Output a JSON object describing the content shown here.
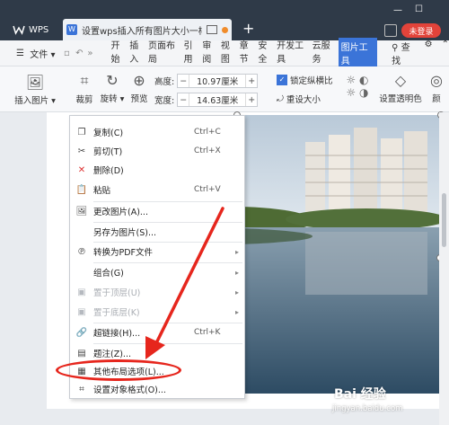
{
  "titlebar": {
    "wps_tab": "WPS",
    "doc_tab": "设置wps插入所有图片大小一样",
    "login_badge": "未登录",
    "new_tab_symbol": "+",
    "minimize_symbol": "—",
    "maximize_symbol": "☐"
  },
  "menubar": {
    "file_label": "文件",
    "tabs": [
      "开始",
      "插入",
      "页面布局",
      "引用",
      "审阅",
      "视图",
      "章节",
      "安全",
      "开发工具",
      "云服务",
      "图片工具"
    ],
    "search_label": "查找"
  },
  "ribbon": {
    "insert_picture": "插入图片",
    "crop": "裁剪",
    "rotate": "旋转",
    "preview": "预览",
    "height_label": "高度:",
    "height_value": "10.97厘米",
    "width_label": "宽度:",
    "width_value": "14.63厘米",
    "lock_ratio": "锁定纵横比",
    "reset_size": "重设大小",
    "set_transparent": "设置透明色",
    "color_partial": "颜"
  },
  "context_menu": {
    "items": [
      {
        "label": "复制(C)",
        "shortcut": "Ctrl+C",
        "icon": "copy-icon"
      },
      {
        "label": "剪切(T)",
        "shortcut": "Ctrl+X",
        "icon": "scissors-icon"
      },
      {
        "label": "删除(D)",
        "shortcut": "",
        "icon": "delete-icon"
      },
      {
        "label": "粘贴",
        "shortcut": "Ctrl+V",
        "icon": "paste-icon"
      },
      {
        "label": "更改图片(A)...",
        "shortcut": "",
        "icon": "change-picture-icon"
      },
      {
        "label": "另存为图片(S)...",
        "shortcut": "",
        "icon": ""
      },
      {
        "label": "转换为PDF文件",
        "shortcut": "",
        "icon": "pdf-icon"
      },
      {
        "label": "组合(G)",
        "shortcut": "",
        "icon": ""
      },
      {
        "label": "置于顶层(U)",
        "shortcut": "",
        "icon": "bring-front-icon"
      },
      {
        "label": "置于底层(K)",
        "shortcut": "",
        "icon": "send-back-icon"
      },
      {
        "label": "超链接(H)...",
        "shortcut": "Ctrl+K",
        "icon": "link-icon"
      },
      {
        "label": "题注(Z)...",
        "shortcut": "",
        "icon": "caption-icon"
      },
      {
        "label": "其他布局选项(L)...",
        "shortcut": "",
        "icon": "layout-options-icon"
      },
      {
        "label": "设置对象格式(O)...",
        "shortcut": "",
        "icon": "format-object-icon"
      }
    ]
  },
  "watermark": {
    "logo_text": "Bai 经验",
    "url": "jingyan.baidu.com"
  },
  "colors": {
    "titlebar": "#2f3a48",
    "accent": "#3b74d8",
    "annotation_red": "#e6261d"
  }
}
